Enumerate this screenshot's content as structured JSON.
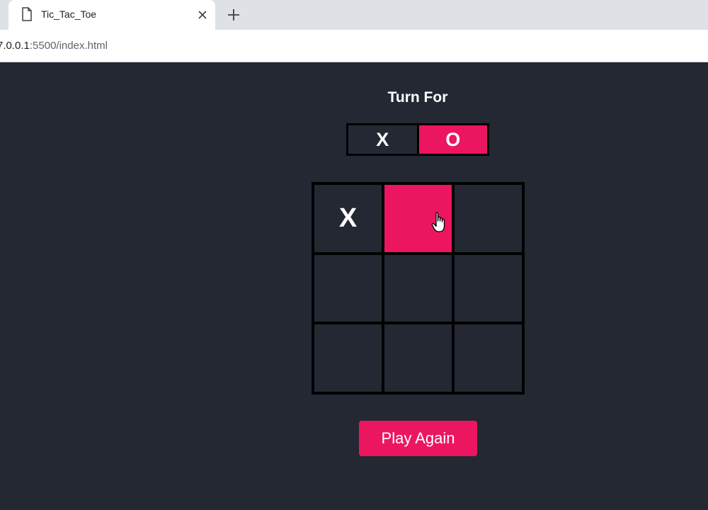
{
  "browser": {
    "tab_title": "Tic_Tac_Toe",
    "url_host": "7.0.0.1",
    "url_rest": ":5500/index.html"
  },
  "game": {
    "turn_heading": "Turn For",
    "turn_options": [
      "X",
      "O"
    ],
    "active_turn": "O",
    "board": [
      "X",
      "",
      "",
      "",
      "",
      "",
      "",
      "",
      ""
    ],
    "hovered_cell": 1,
    "play_again_label": "Play Again"
  },
  "colors": {
    "background": "#242833",
    "accent": "#ec1660",
    "grid": "#000000"
  },
  "icons": {
    "tab": "file-icon",
    "close": "close-icon",
    "new_tab": "plus-icon",
    "pointer": "hand-cursor-icon"
  }
}
